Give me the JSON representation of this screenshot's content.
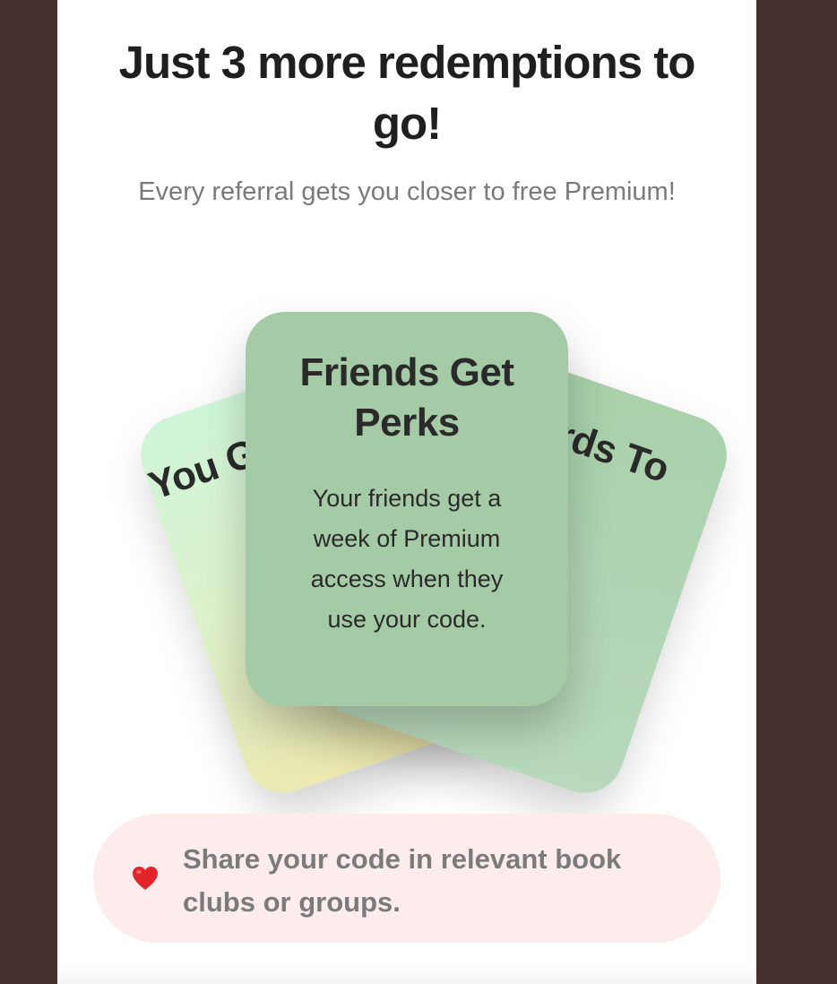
{
  "header": {
    "title": "Just 3 more redemptions to go!",
    "subtitle": "Every referral gets you closer to free Premium!"
  },
  "cards": {
    "left": {
      "title": "You Get Premium",
      "body": ""
    },
    "right": {
      "title": "Rewards To",
      "body": ""
    },
    "front": {
      "title": "Friends Get Perks",
      "body": "Your friends get a week of Premium access when they use your code."
    }
  },
  "tip": {
    "icon": "heart-icon",
    "text": "Share your code in relevant book clubs or groups."
  },
  "colors": {
    "background": "#46302e",
    "panel": "#ffffff",
    "front_card": "#a4cba5",
    "tip_background": "#fdecec",
    "heart": "#e3242b"
  }
}
